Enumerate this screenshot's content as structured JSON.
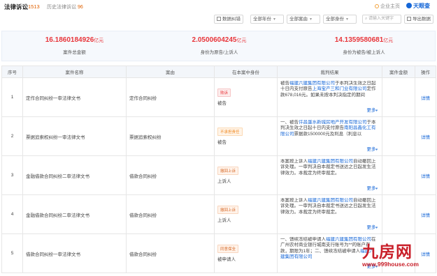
{
  "header": {
    "title": "法律诉讼",
    "count": "1513",
    "history_label": "历史法律诉讼",
    "history_count": "96",
    "enterprise_label": "企业主页",
    "logo_text": "天眼查"
  },
  "toolbar": {
    "data_analysis": "数据纠错",
    "filters": [
      {
        "label": "全部年份"
      },
      {
        "label": "全部案由"
      },
      {
        "label": "全部身份"
      }
    ],
    "search_placeholder": "请输入关键字",
    "export": "导出数据"
  },
  "stats": [
    {
      "value": "16.1860184926",
      "unit": "亿元",
      "label": "案件总金额"
    },
    {
      "value": "2.0500604245",
      "unit": "亿元",
      "label": "身份为原告/上诉人"
    },
    {
      "value": "14.1359580681",
      "unit": "亿元",
      "label": "身份为被告/被上诉人"
    }
  ],
  "table": {
    "headers": [
      "序号",
      "案件名称",
      "案由",
      "在本案中身份",
      "裁判结果",
      "案件金额",
      "操作"
    ],
    "rows": [
      {
        "no": "1",
        "name": "定作合同纠纷一审法律文书",
        "cause": "定作合同纠纷",
        "tag": "败诉",
        "tag_color": "#e8353a",
        "role": "被告",
        "result_prefix": "被告",
        "result_hl1": "福建六建集团有限公司",
        "result_mid": "于本判决生效之日起十日内支付原告",
        "result_hl2": "上海宝产三和门业有限公司",
        "result_tail": "定作款678,016元。如果未按本判决指定的期间",
        "amount": "",
        "action": "详情"
      },
      {
        "no": "2",
        "name": "票据追索权纠纷一审法律文书",
        "cause": "票据追索权纠纷",
        "tag": "不承担责任",
        "tag_color": "#f08a24",
        "role": "被告",
        "result_prefix": "一、被告",
        "result_hl1": "许昌蛋水新城房地产开发有限公司",
        "result_mid": "于本判决生效之日起十日内支付原告",
        "result_hl2": "南阳昌鑫化工有限公司",
        "result_tail": "票据款1500000元及利息（利息以",
        "amount": "",
        "action": "详情"
      },
      {
        "no": "3",
        "name": "金融借款合同纠纷二审法律文书",
        "cause": "借款合同纠纷",
        "tag": "撤回上诉",
        "tag_color": "#d76b2a",
        "role": "上诉人",
        "result_prefix": "本案按上诉人",
        "result_hl1": "福建六建集团有限公司",
        "result_mid": "自动撤回上诉处理。一审判决自本裁定书送达之日起发生法律效力。本裁定为终审裁定。",
        "result_hl2": "",
        "result_tail": "",
        "amount": "",
        "action": "详情"
      },
      {
        "no": "4",
        "name": "金融借款合同纠纷二审法律文书",
        "cause": "借款合同纠纷",
        "tag": "撤回上诉",
        "tag_color": "#d76b2a",
        "role": "上诉人",
        "result_prefix": "本案按上诉人",
        "result_hl1": "福建六建集团有限公司",
        "result_mid": "自动撤回上诉处理。一审判决自本裁定书送达之日起发生法律效力。本裁定为终审裁定。",
        "result_hl2": "",
        "result_tail": "",
        "amount": "",
        "action": "详情"
      },
      {
        "no": "5",
        "name": "借款合同纠纷一审法律文书",
        "cause": "借款合同纠纷",
        "tag": "同意保全",
        "tag_color": "#d76b2a",
        "role": "被申请人",
        "result_prefix": "一、馈续冻结被申请人",
        "result_hl1": "福建六建集团有限公司",
        "result_mid": "在广州农村商业银行城南支行账号为**的账户存款，期限为1年；二、馈续冻结被申请人",
        "result_hl2": "福建六建集团有限公司",
        "result_tail": "",
        "amount": "",
        "action": "详情"
      }
    ],
    "more_label": "更多"
  },
  "watermark": {
    "big": "九房网",
    "url": "www.999house.com"
  }
}
